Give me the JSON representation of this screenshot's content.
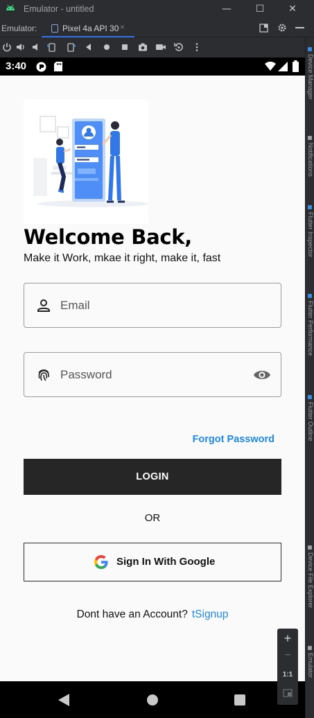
{
  "window": {
    "title": "Emulator - untitled",
    "controls": {
      "minimize": "—",
      "maximize": "☐",
      "close": "✕"
    }
  },
  "tabs": {
    "label": "Emulator:",
    "active_tab": "Pixel 4a API 30",
    "close_glyph": "×",
    "right_icons": [
      "layout-icon",
      "gear-icon",
      "minimize-icon"
    ]
  },
  "toolbar": {
    "icons": [
      "power-icon",
      "volume-up-icon",
      "volume-down-icon",
      "rotate-left-icon",
      "rotate-right-icon",
      "back-icon",
      "home-icon",
      "overview-icon",
      "camera-icon",
      "record-icon",
      "reset-icon",
      "more-icon"
    ]
  },
  "side_panel": {
    "labels": [
      "Device Manager",
      "Notifications",
      "Flutter Inspector",
      "Flutter Performance",
      "Flutter Outline",
      "Device File Explorer",
      "Emulator"
    ]
  },
  "status_bar": {
    "time": "3:40"
  },
  "app": {
    "welcome": "Welcome Back,",
    "subtitle": "Make it Work, mkae it right, make it, fast",
    "email_placeholder": "Email",
    "password_placeholder": "Password",
    "forgot_password": "Forgot Password",
    "login_label": "LOGIN",
    "or_label": "OR",
    "google_label": "Sign In With Google",
    "signup_prompt": "Dont have an Account?",
    "signup_link": "tSignup",
    "colors": {
      "accent": "#1e88e5",
      "button": "#262626",
      "background": "#fafafa"
    }
  },
  "zoom_panel": {
    "plus": "+",
    "minus": "−",
    "one_to_one": "1:1"
  }
}
